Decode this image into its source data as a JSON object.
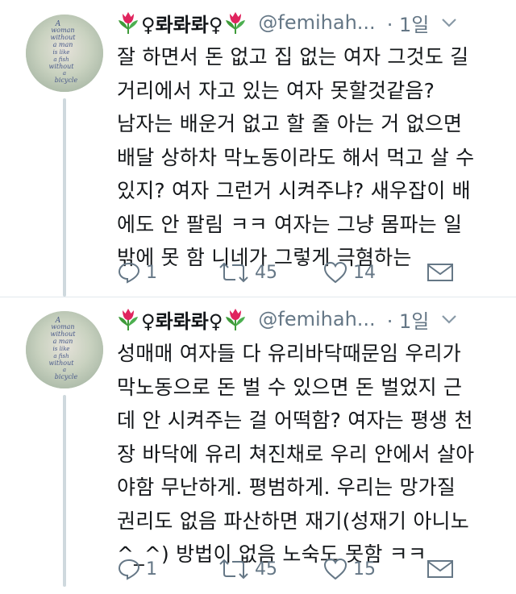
{
  "tweets": [
    {
      "display_name": "♀롸롸롸♀",
      "handle": "@femihah...",
      "time": "· 1일",
      "lines": [
        "잘 하면서 돈 없고 집 없는 여자 그것도 길",
        "거리에서 자고 있는 여자 못할것같음?",
        "남자는 배운거 없고 할 줄 아는 거 없으면",
        "배달 상하차 막노동이라도 해서 먹고 살 수",
        "있지? 여자 그런거 시켜주냐? 새우잡이 배",
        "에도 안 팔림 ㅋㅋ 여자는 그냥 몸파는 일",
        "밖에 못 함 니네가 그렇게 극혐하는"
      ],
      "replies": "1",
      "retweets": "45",
      "likes": "14",
      "avatar_text": [
        "A",
        "woman",
        "without",
        "a man",
        "is like",
        "a fish",
        "without",
        "a",
        "bicycle"
      ]
    },
    {
      "display_name": "♀롸롸롸♀",
      "handle": "@femihah...",
      "time": "· 1일",
      "lines": [
        "성매매 여자들 다 유리바닥때문임 우리가",
        "막노동으로 돈 벌 수 있으면 돈 벌었지 근",
        "데 안 시켜주는 걸 어떡함? 여자는 평생 천",
        "장 바닥에 유리 쳐진채로 우리 안에서 살아",
        "야함 무난하게. 평범하게. 우리는 망가질",
        "권리도 없음 파산하면 재기(성재기 아니노",
        "^_^) 방법이 없음 노숙도 못함 ㅋㅋ"
      ],
      "replies": "1",
      "retweets": "45",
      "likes": "15",
      "avatar_text": [
        "A",
        "woman",
        "without",
        "a man",
        "is like",
        "a fish",
        "without",
        "a",
        "bicycle"
      ]
    }
  ],
  "colors": {
    "text": "#14171a",
    "secondary": "#657786",
    "tulip": "#e0245e",
    "leaf": "#3f9b3a",
    "thread": "#cfd9de"
  },
  "icons": {
    "reply": "reply-icon",
    "retweet": "retweet-icon",
    "like": "heart-icon",
    "dm": "envelope-icon",
    "menu": "chevron-down-icon",
    "emoji": "tulip-icon"
  }
}
